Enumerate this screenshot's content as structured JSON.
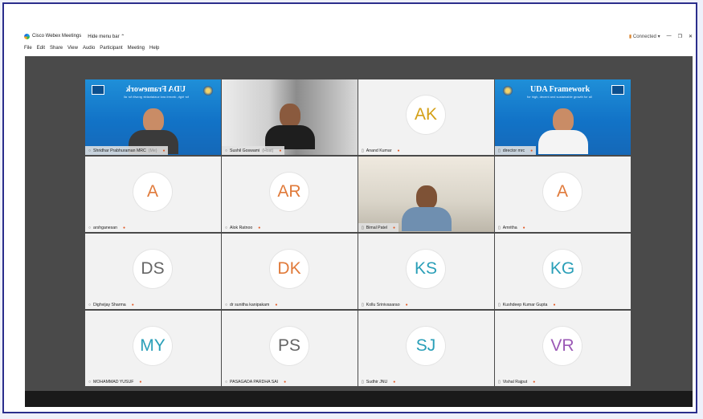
{
  "window": {
    "title": "Cisco Webex Meetings",
    "hide_menu": "Hide menu bar ⌃",
    "status": "Connected",
    "status_caret": "▾",
    "controls": [
      "—",
      "❐",
      "✕"
    ]
  },
  "menu": [
    "File",
    "Edit",
    "Share",
    "View",
    "Audio",
    "Participant",
    "Meeting",
    "Help"
  ],
  "banner": {
    "title": "UDA Framework",
    "subtitle": "for high, decent and sustainable growth for all"
  },
  "participants": [
    {
      "name": "Shridhar Prabhuraman MRC",
      "tag": "(Me)",
      "video": "banner-mirror"
    },
    {
      "name": "Sushil Goswami",
      "tag": "(Host)",
      "video": "camera"
    },
    {
      "name": "Anand Kumar",
      "initials": "AK",
      "color": "#d4a017"
    },
    {
      "name": "director mrc",
      "video": "banner"
    },
    {
      "name": "arshganesan",
      "initials": "A",
      "color": "#e07a3a"
    },
    {
      "name": "Alok Ratnoo",
      "initials": "AR",
      "color": "#e07a3a"
    },
    {
      "name": "Bimal Patel",
      "video": "camera"
    },
    {
      "name": "Amritha",
      "initials": "A",
      "color": "#e07a3a"
    },
    {
      "name": "Dighvijay Sharma",
      "initials": "DS",
      "color": "#666666"
    },
    {
      "name": "dr sunitha kanipakam",
      "initials": "DK",
      "color": "#e07a3a"
    },
    {
      "name": "Kollu Srinivasarao",
      "initials": "KS",
      "color": "#2a9fb8"
    },
    {
      "name": "Kushdeep Kumar Gupta",
      "initials": "KG",
      "color": "#2a9fb8"
    },
    {
      "name": "MOHAMMAD YUSUF",
      "initials": "MY",
      "color": "#2a9fb8"
    },
    {
      "name": "PASAGADA PARDHA SAI",
      "initials": "PS",
      "color": "#666666"
    },
    {
      "name": "Sudhir JNU",
      "initials": "SJ",
      "color": "#2a9fb8"
    },
    {
      "name": "Vishal Rajput",
      "initials": "VR",
      "color": "#9b59b6"
    }
  ]
}
